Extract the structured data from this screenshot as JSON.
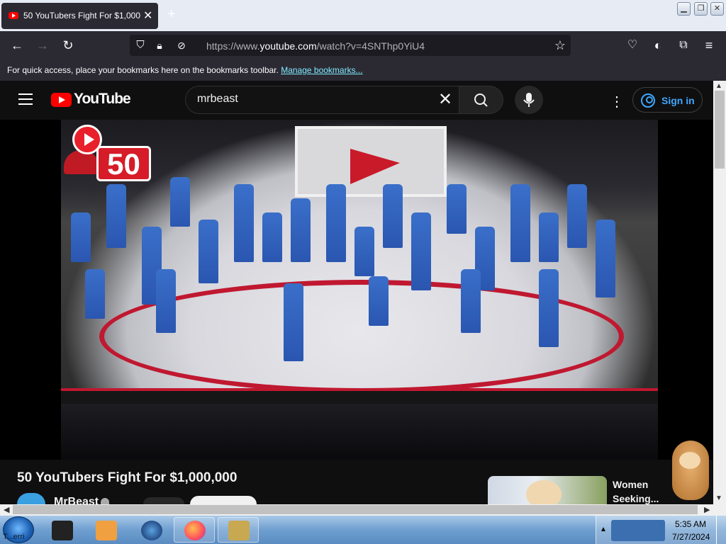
{
  "browser": {
    "tab_title": "50 YouTubers Fight For $1,000,000",
    "url_prefix": "https://www.",
    "url_host": "youtube.com",
    "url_path": "/watch?v=4SNThp0YiU4",
    "bookmarks_text": "For quick access, place your bookmarks here on the bookmarks toolbar.",
    "bookmarks_link": "Manage bookmarks..."
  },
  "youtube": {
    "logo_text": "YouTube",
    "search_value": "mrbeast",
    "sign_in": "Sign in",
    "video_title": "50 YouTubers Fight For $1,000,000",
    "channel_name": "MrBeast",
    "video_badge_number": "50",
    "ad_title": "Women Seeking..."
  },
  "taskbar": {
    "start_label": "T...erri",
    "time": "5:35 AM",
    "date": "7/27/2024",
    "pinned": [
      "task-view-icon",
      "media-player-icon",
      "browser-globe-icon",
      "firefox-icon",
      "game-box-icon"
    ]
  },
  "colors": {
    "youtube_red": "#ff0000",
    "link_blue": "#3ea6ff",
    "browser_dark": "#2b2a33"
  }
}
